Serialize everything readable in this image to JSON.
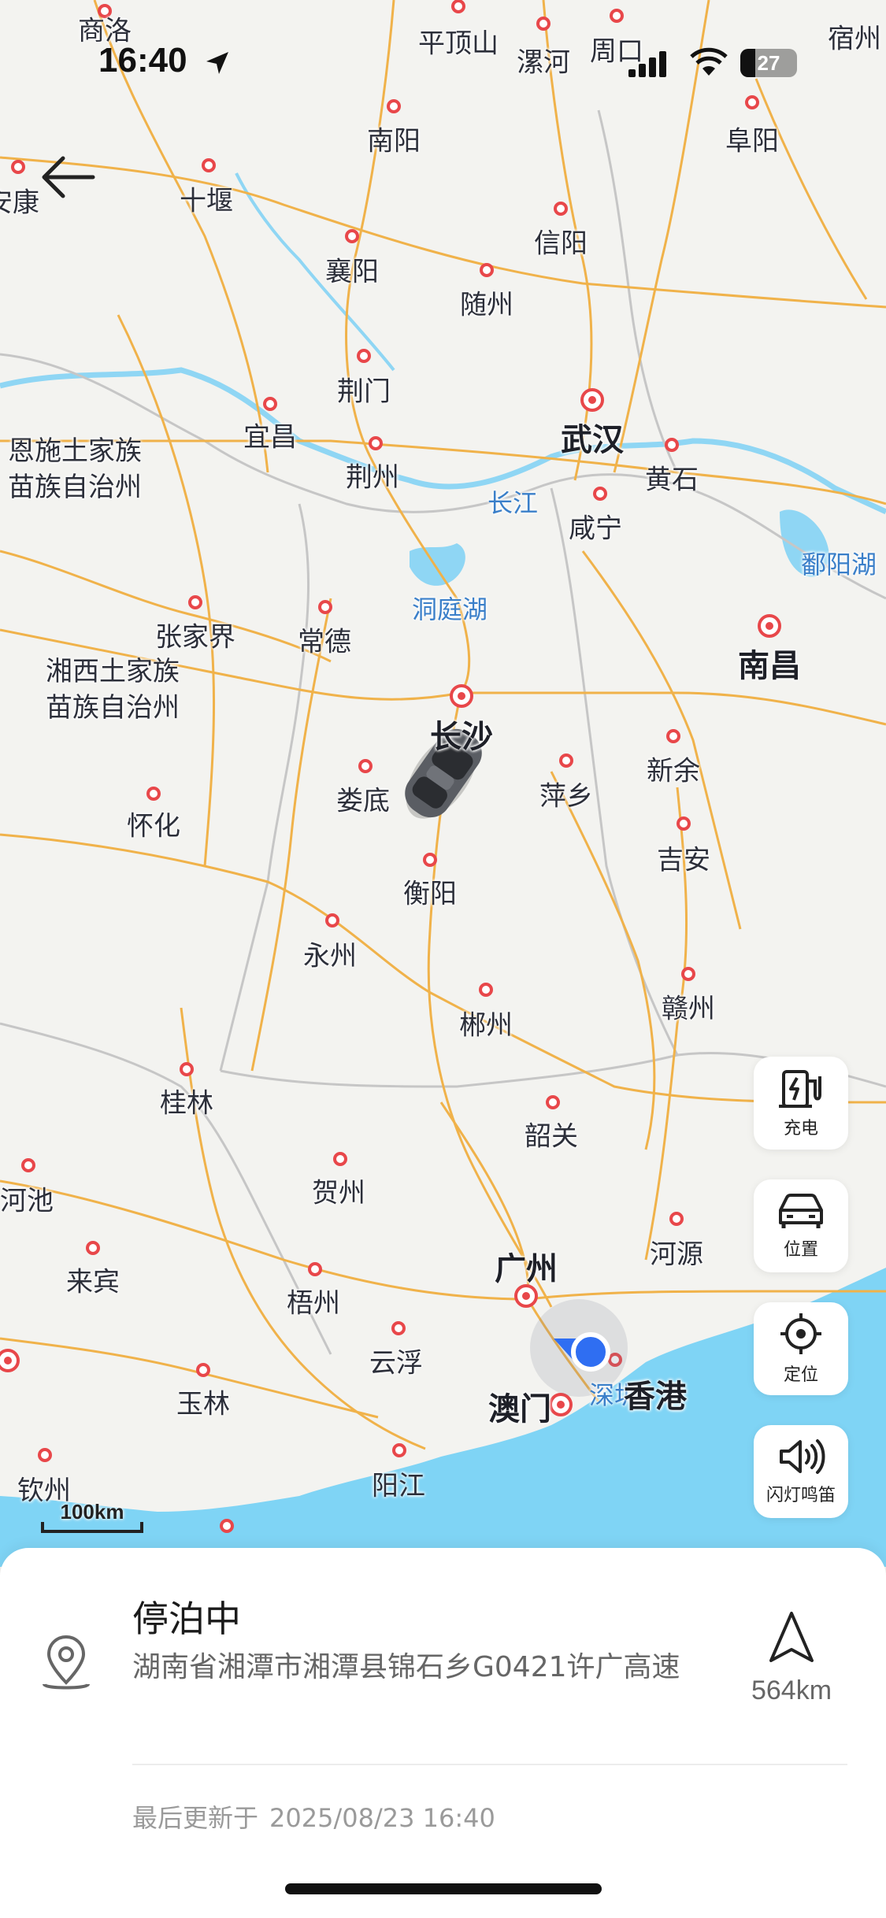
{
  "status_bar": {
    "time": "16:40",
    "battery_level": 27,
    "battery_text": "27"
  },
  "map": {
    "cities": [
      {
        "name": "商洛",
        "style": "normal"
      },
      {
        "name": "平顶山",
        "style": "normal"
      },
      {
        "name": "漯河",
        "style": "normal"
      },
      {
        "name": "周口",
        "style": "normal"
      },
      {
        "name": "宿州",
        "style": "normal"
      },
      {
        "name": "南阳",
        "style": "normal"
      },
      {
        "name": "阜阳",
        "style": "normal"
      },
      {
        "name": "安康",
        "style": "normal"
      },
      {
        "name": "十堰",
        "style": "normal"
      },
      {
        "name": "信阳",
        "style": "normal"
      },
      {
        "name": "襄阳",
        "style": "normal"
      },
      {
        "name": "随州",
        "style": "normal"
      },
      {
        "name": "荆门",
        "style": "normal"
      },
      {
        "name": "宜昌",
        "style": "normal"
      },
      {
        "name": "武汉",
        "style": "big"
      },
      {
        "name": "荆州",
        "style": "normal"
      },
      {
        "name": "黄石",
        "style": "normal"
      },
      {
        "name": "长江",
        "style": "water"
      },
      {
        "name": "咸宁",
        "style": "normal"
      },
      {
        "name": "鄱阳湖",
        "style": "water"
      },
      {
        "name": "张家界",
        "style": "normal"
      },
      {
        "name": "常德",
        "style": "normal"
      },
      {
        "name": "洞庭湖",
        "style": "water"
      },
      {
        "name": "南昌",
        "style": "big"
      },
      {
        "name": "长沙",
        "style": "big"
      },
      {
        "name": "新余",
        "style": "normal"
      },
      {
        "name": "娄底",
        "style": "normal"
      },
      {
        "name": "萍乡",
        "style": "normal"
      },
      {
        "name": "怀化",
        "style": "normal"
      },
      {
        "name": "吉安",
        "style": "normal"
      },
      {
        "name": "衡阳",
        "style": "normal"
      },
      {
        "name": "永州",
        "style": "normal"
      },
      {
        "name": "郴州",
        "style": "normal"
      },
      {
        "name": "赣州",
        "style": "normal"
      },
      {
        "name": "桂林",
        "style": "normal"
      },
      {
        "name": "韶关",
        "style": "normal"
      },
      {
        "name": "贺州",
        "style": "normal"
      },
      {
        "name": "河池",
        "style": "normal"
      },
      {
        "name": "河源",
        "style": "normal"
      },
      {
        "name": "广州",
        "style": "big"
      },
      {
        "name": "来宾",
        "style": "normal"
      },
      {
        "name": "梧州",
        "style": "normal"
      },
      {
        "name": "云浮",
        "style": "normal"
      },
      {
        "name": "深圳",
        "style": "water"
      },
      {
        "name": "香港",
        "style": "big"
      },
      {
        "name": "玉林",
        "style": "normal"
      },
      {
        "name": "澳门",
        "style": "big"
      },
      {
        "name": "阳江",
        "style": "normal"
      },
      {
        "name": "钦州",
        "style": "normal"
      }
    ],
    "regions": [
      "恩施土家族\n苗族自治州",
      "湘西土家族\n苗族自治州"
    ],
    "scale_label": "100km",
    "colors": {
      "land": "#f3f3f0",
      "water": "#7fd4f5",
      "road": "#f0b24a",
      "city_dot": "#e8474a"
    }
  },
  "side_buttons": [
    {
      "label": "充电",
      "icon": "charging-station-icon"
    },
    {
      "label": "位置",
      "icon": "car-icon"
    },
    {
      "label": "定位",
      "icon": "locate-crosshair-icon"
    },
    {
      "label": "闪灯鸣笛",
      "icon": "horn-speaker-icon"
    }
  ],
  "vehicle_info": {
    "status": "停泊中",
    "address": "湖南省湘潭市湘潭县锦石乡G0421许广高速",
    "distance": "564km",
    "update_prefix": "最后更新于",
    "update_time": "2025/08/23 16:40"
  }
}
